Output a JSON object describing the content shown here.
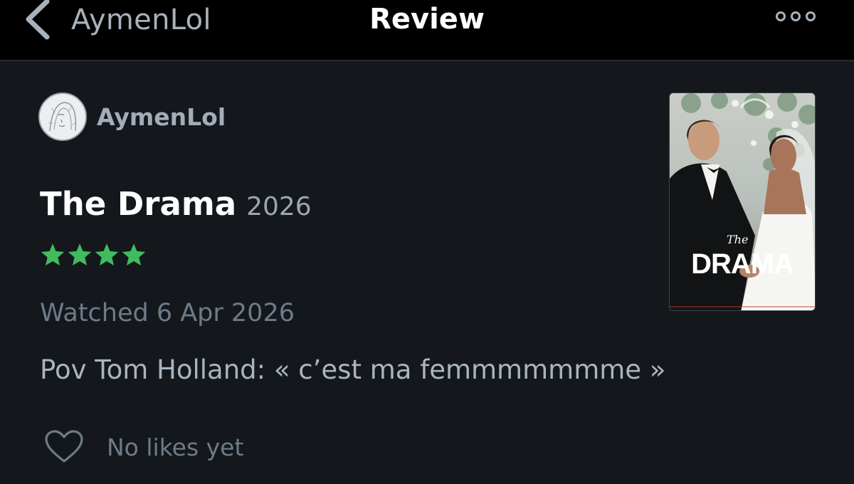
{
  "nav": {
    "back_label": "AymenLol",
    "title": "Review",
    "back_icon": "chevron-left-icon",
    "more_icon": "more-dots-icon"
  },
  "review": {
    "author": "AymenLol",
    "film_title": "The Drama",
    "film_year": "2026",
    "rating_stars": 4,
    "star_color": "#40bc5e",
    "watched": "Watched 6 Apr 2026",
    "text": "Pov Tom Holland: « c’est ma femmmmmmme »",
    "likes_label": "No likes yet",
    "like_icon": "heart-outline-icon"
  },
  "poster": {
    "title_small": "The",
    "title_large": "DRAMA"
  }
}
